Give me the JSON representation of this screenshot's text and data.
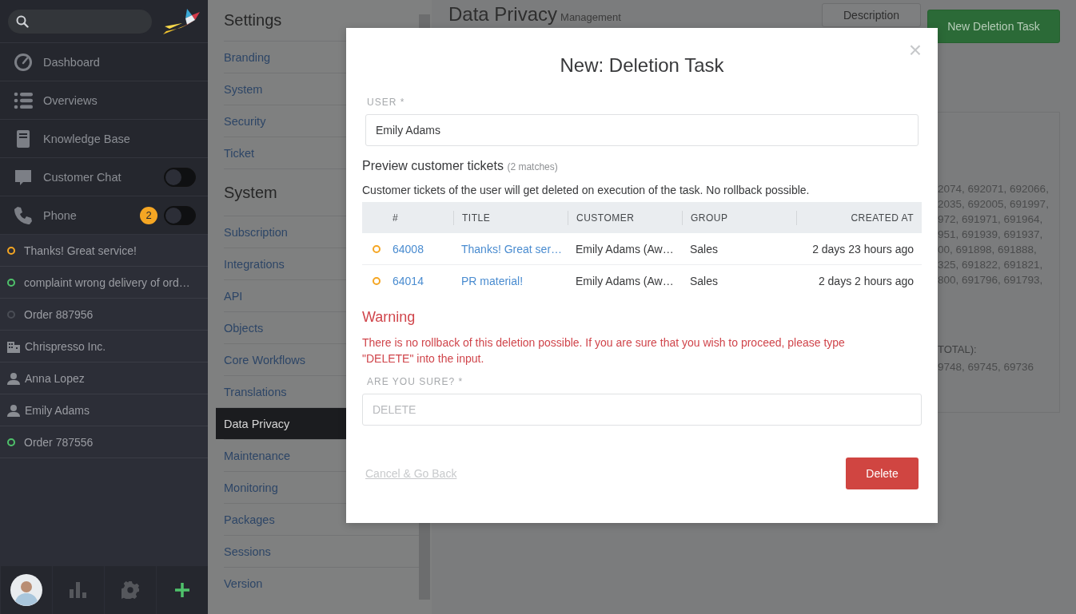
{
  "sidebar": {
    "nav": [
      {
        "label": "Dashboard"
      },
      {
        "label": "Overviews"
      },
      {
        "label": "Knowledge Base"
      },
      {
        "label": "Customer Chat",
        "toggle_on": false
      },
      {
        "label": "Phone",
        "badge": "2",
        "toggle_on": false
      }
    ],
    "recent": [
      {
        "kind": "ticket",
        "label": "Thanks! Great service!",
        "color": "#f5a623"
      },
      {
        "kind": "ticket",
        "label": "complaint wrong delivery of ord…",
        "color": "#4fc26b"
      },
      {
        "kind": "ticket",
        "label": "Order 887956",
        "color": "#4a4d55"
      },
      {
        "kind": "organization",
        "label": "Chrispresso Inc."
      },
      {
        "kind": "user",
        "label": "Anna Lopez"
      },
      {
        "kind": "user",
        "label": "Emily Adams"
      },
      {
        "kind": "ticket",
        "label": "Order 787556",
        "color": "#4fc26b"
      }
    ]
  },
  "settings": {
    "sections": [
      {
        "title": "Settings",
        "items": [
          {
            "label": "Branding",
            "selected": false
          },
          {
            "label": "System",
            "selected": false
          },
          {
            "label": "Security",
            "selected": false
          },
          {
            "label": "Ticket",
            "selected": false
          }
        ]
      },
      {
        "title": "System",
        "items": [
          {
            "label": "Subscription",
            "selected": false
          },
          {
            "label": "Integrations",
            "selected": false
          },
          {
            "label": "API",
            "selected": false
          },
          {
            "label": "Objects",
            "selected": false
          },
          {
            "label": "Core Workflows",
            "selected": false
          },
          {
            "label": "Translations",
            "selected": false
          },
          {
            "label": "Data Privacy",
            "selected": true
          },
          {
            "label": "Maintenance",
            "selected": false
          },
          {
            "label": "Monitoring",
            "selected": false
          },
          {
            "label": "Packages",
            "selected": false
          },
          {
            "label": "Sessions",
            "selected": false
          },
          {
            "label": "Version",
            "selected": false
          }
        ]
      }
    ]
  },
  "main": {
    "title": "Data Privacy",
    "subtitle": "Management",
    "buttons": [
      {
        "label": "Description",
        "kind": "secondary"
      },
      {
        "label": "New Deletion Task",
        "kind": "primary"
      }
    ],
    "list_lines": [
      "2074, 692071, 692066,",
      "2035, 692005, 691997,",
      "972, 691971, 691964,",
      "951, 691939, 691937,",
      "00, 691898, 691888,",
      "325, 691822, 691821,",
      "800, 691796, 691793,"
    ],
    "total_heading": "TOTAL):",
    "total_line": "9748, 69745, 69736"
  },
  "modal": {
    "title": "New: Deletion Task",
    "close": "×",
    "user_label": "USER *",
    "user_value": "Emily Adams",
    "preview_title": "Preview customer tickets",
    "preview_count": "(2 matches)",
    "preview_note": "Customer tickets of the user will get deleted on execution of the task. No rollback possible.",
    "table": {
      "columns": [
        "#",
        "TITLE",
        "CUSTOMER",
        "GROUP",
        "CREATED AT"
      ],
      "rows": [
        {
          "color": "#f5a623",
          "number": "64008",
          "title": "Thanks! Great ser…",
          "customer": "Emily Adams (Aw…",
          "group": "Sales",
          "created_at": "2 days 23 hours ago"
        },
        {
          "color": "#f5a623",
          "number": "64014",
          "title": "PR material!",
          "customer": "Emily Adams (Aw…",
          "group": "Sales",
          "created_at": "2 days 2 hours ago"
        }
      ]
    },
    "warning_title": "Warning",
    "warning_text": "There is no rollback of this deletion possible. If you are sure that you wish to proceed, please type \"DELETE\" into the input.",
    "confirm_label": "ARE YOU SURE? *",
    "confirm_placeholder": "DELETE",
    "cancel": "Cancel & Go Back",
    "submit": "Delete"
  }
}
